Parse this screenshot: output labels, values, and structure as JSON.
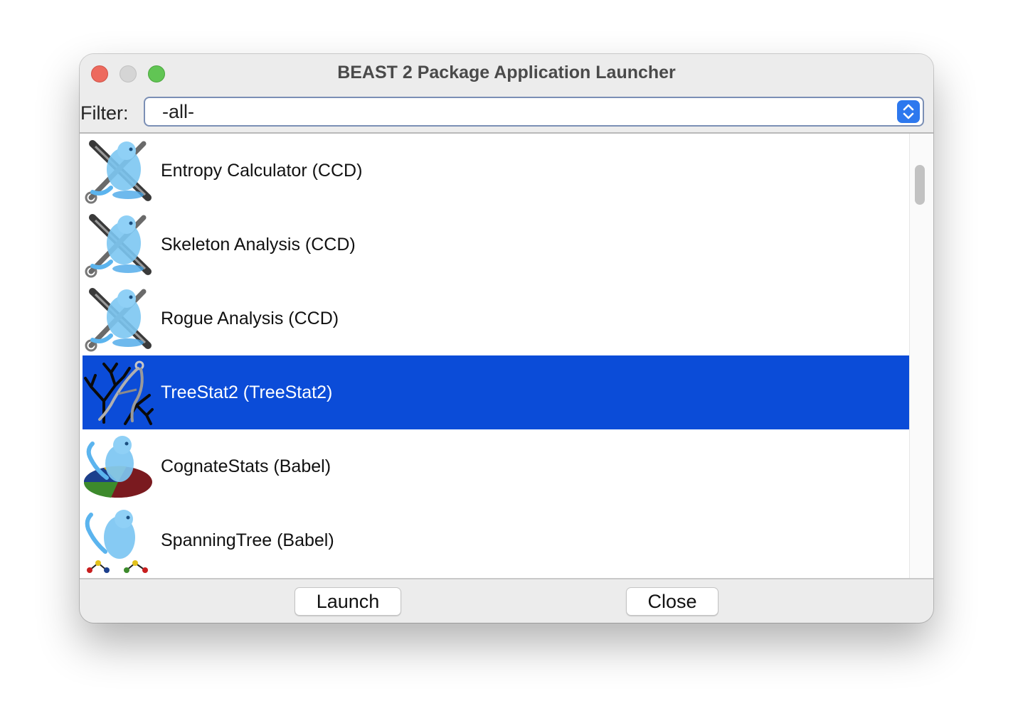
{
  "window": {
    "title": "BEAST 2 Package Application Launcher"
  },
  "filter": {
    "label": "Filter:",
    "value": "-all-"
  },
  "apps": [
    {
      "label": "Entropy Calculator (CCD)",
      "icon": "beast-tools-icon",
      "selected": false
    },
    {
      "label": "Skeleton Analysis (CCD)",
      "icon": "beast-tools-icon",
      "selected": false
    },
    {
      "label": "Rogue Analysis (CCD)",
      "icon": "beast-tools-icon",
      "selected": false
    },
    {
      "label": "TreeStat2 (TreeStat2)",
      "icon": "tree-calipers-icon",
      "selected": true
    },
    {
      "label": "CognateStats (Babel)",
      "icon": "beast-pie-chart-icon",
      "selected": false
    },
    {
      "label": "SpanningTree (Babel)",
      "icon": "beast-network-icon",
      "selected": false
    }
  ],
  "buttons": {
    "launch": "Launch",
    "close": "Close"
  },
  "colors": {
    "selection": "#0b4cd8",
    "select_arrow": "#2d78ee",
    "close_light": "#ed6a5e",
    "zoom_light": "#61c554"
  }
}
